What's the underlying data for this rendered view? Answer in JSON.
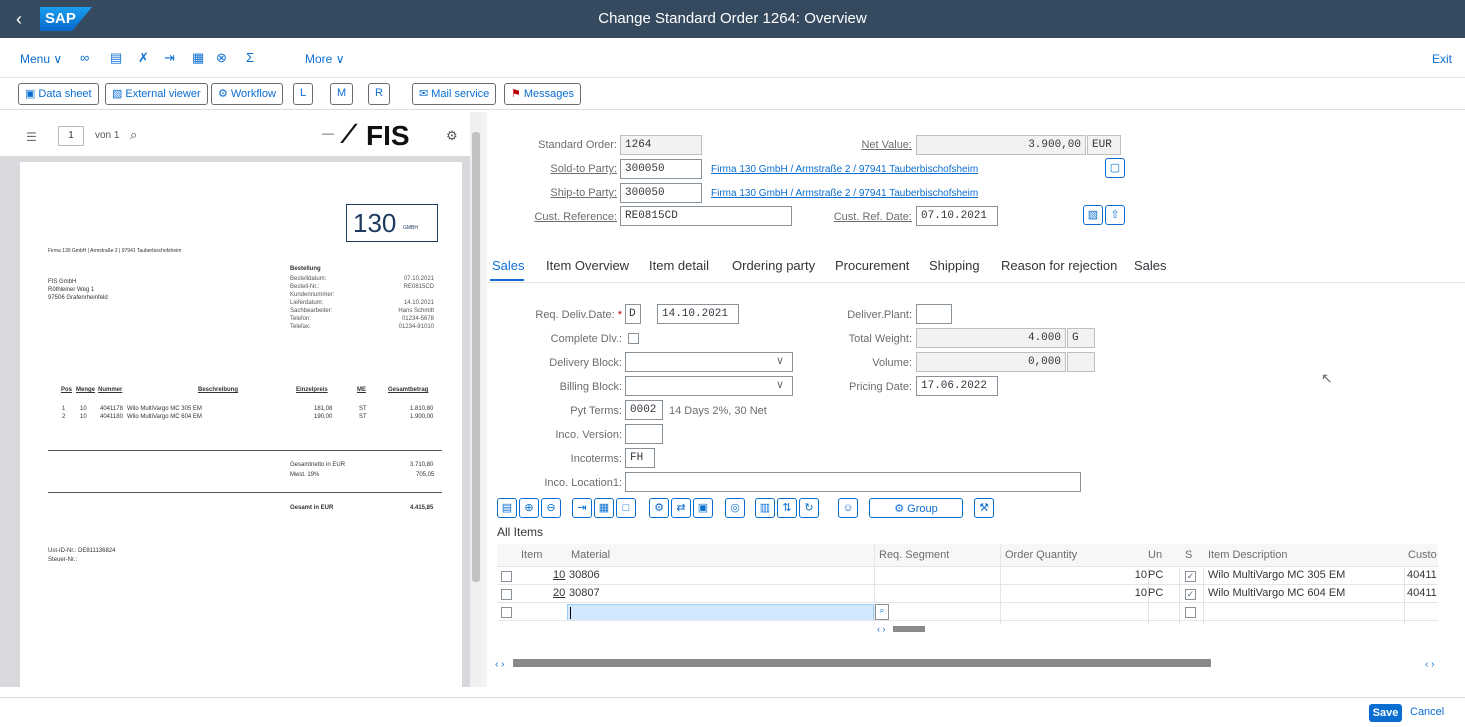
{
  "shell": {
    "back_icon": "chevron-left-icon",
    "logo": "SAP",
    "title": "Change Standard Order 1264: Overview"
  },
  "menubar": {
    "menu_label": "Menu",
    "more_label": "More",
    "exit_label": "Exit",
    "sigma": "Σ"
  },
  "toolbar": {
    "data_sheet": "Data sheet",
    "external_viewer": "External viewer",
    "workflow": "Workflow",
    "l": "L",
    "m": "M",
    "r": "R",
    "mail_service": "Mail service",
    "messages": "Messages"
  },
  "pdf": {
    "page_value": "1",
    "page_of": "von 1",
    "brand": "FIS",
    "logo_number": "130",
    "logo_suffix": "GMBH",
    "sender_line": "Firma 130 GmbH | Armstraße 2 | 97941 Tauberbischofsheim",
    "address": [
      "FIS GmbH",
      "Röthleiner Weg 1",
      "97506 Grafenrheinfeld"
    ],
    "order_title": "Bestellung",
    "info_labels": [
      "Bestelldatum:",
      "Bestell-Nr.:",
      "Kundennummer:",
      "Lieferdatum:",
      "Sachbearbeiter:",
      "Telefon:",
      "Telefax:"
    ],
    "info_values": [
      "07.10.2021",
      "RE0815CD",
      "",
      "14.10.2021",
      "Hans Schmitt",
      "01234-5678",
      "01234-91010"
    ],
    "table_headers": [
      "Pos",
      "Menge",
      "Nummer",
      "Beschreibung",
      "Einzelpreis",
      "ME",
      "Gesamtbetrag"
    ],
    "rows": [
      [
        "1",
        "10",
        "4041178",
        "Wilo MultiVargo MC 305 EM",
        "181,08",
        "ST",
        "1.810,80"
      ],
      [
        "2",
        "10",
        "4041180",
        "Wilo MultiVargo MC 604 EM",
        "190,00",
        "ST",
        "1.900,00"
      ]
    ],
    "net_label": "Gesamtnetto in EUR",
    "net_value": "3.710,80",
    "vat_label": "Mwst. 19%",
    "vat_value": "705,05",
    "total_label": "Gesamt in EUR",
    "total_value": "4.415,85",
    "vat_id": "Ust-ID-Nr.: DE811136824",
    "tax_no": "Steuer-Nr.:"
  },
  "header": {
    "standard_order_label": "Standard Order:",
    "standard_order_value": "1264",
    "net_value_label": "Net Value:",
    "net_value_value": "3.900,00",
    "currency": "EUR",
    "sold_to_label": "Sold-to Party:",
    "sold_to_value": "300050",
    "sold_to_desc": "Firma 130 GmbH / Armstraße 2 / 97941 Tauberbischofsheim",
    "ship_to_label": "Ship-to Party:",
    "ship_to_value": "300050",
    "ship_to_desc": "Firma 130 GmbH / Armstraße 2 / 97941 Tauberbischofsheim",
    "cust_ref_label": "Cust. Reference:",
    "cust_ref_value": "RE0815CD",
    "cust_ref_date_label": "Cust. Ref. Date:",
    "cust_ref_date_value": "07.10.2021"
  },
  "tabs": [
    "Sales",
    "Item Overview",
    "Item detail",
    "Ordering party",
    "Procurement",
    "Shipping",
    "Reason for rejection",
    "Sales"
  ],
  "sales": {
    "req_deliv_label": "Req. Deliv.Date:",
    "req_deliv_unit": "D",
    "req_deliv_value": "14.10.2021",
    "complete_dlv_label": "Complete Dlv.:",
    "delivery_block_label": "Delivery Block:",
    "billing_block_label": "Billing Block:",
    "pyt_terms_label": "Pyt Terms:",
    "pyt_terms_value": "0002",
    "pyt_terms_desc": "14 Days 2%, 30 Net",
    "inco_version_label": "Inco. Version:",
    "incoterms_label": "Incoterms:",
    "incoterms_value": "FH",
    "inco_location_label": "Inco. Location1:",
    "deliver_plant_label": "Deliver.Plant:",
    "total_weight_label": "Total Weight:",
    "total_weight_value": "4.000",
    "weight_unit": "G",
    "volume_label": "Volume:",
    "volume_value": "0,000",
    "pricing_date_label": "Pricing Date:",
    "pricing_date_value": "17.06.2022"
  },
  "items": {
    "section_title": "All Items",
    "group_button": "Group",
    "columns": [
      "Item",
      "Material",
      "Req. Segment",
      "Order Quantity",
      "Un",
      "S",
      "Item Description",
      "Custo"
    ],
    "rows": [
      {
        "item": "10",
        "material": "30806",
        "qty": "10",
        "unit": "PC",
        "desc": "Wilo MultiVargo MC 305 EM",
        "cust": "40411"
      },
      {
        "item": "20",
        "material": "30807",
        "qty": "10",
        "unit": "PC",
        "desc": "Wilo MultiVargo MC 604 EM",
        "cust": "40411"
      }
    ]
  },
  "footer": {
    "save": "Save",
    "cancel": "Cancel"
  },
  "colors": {
    "shell": "#354a5f",
    "accent": "#0a6ed1"
  }
}
